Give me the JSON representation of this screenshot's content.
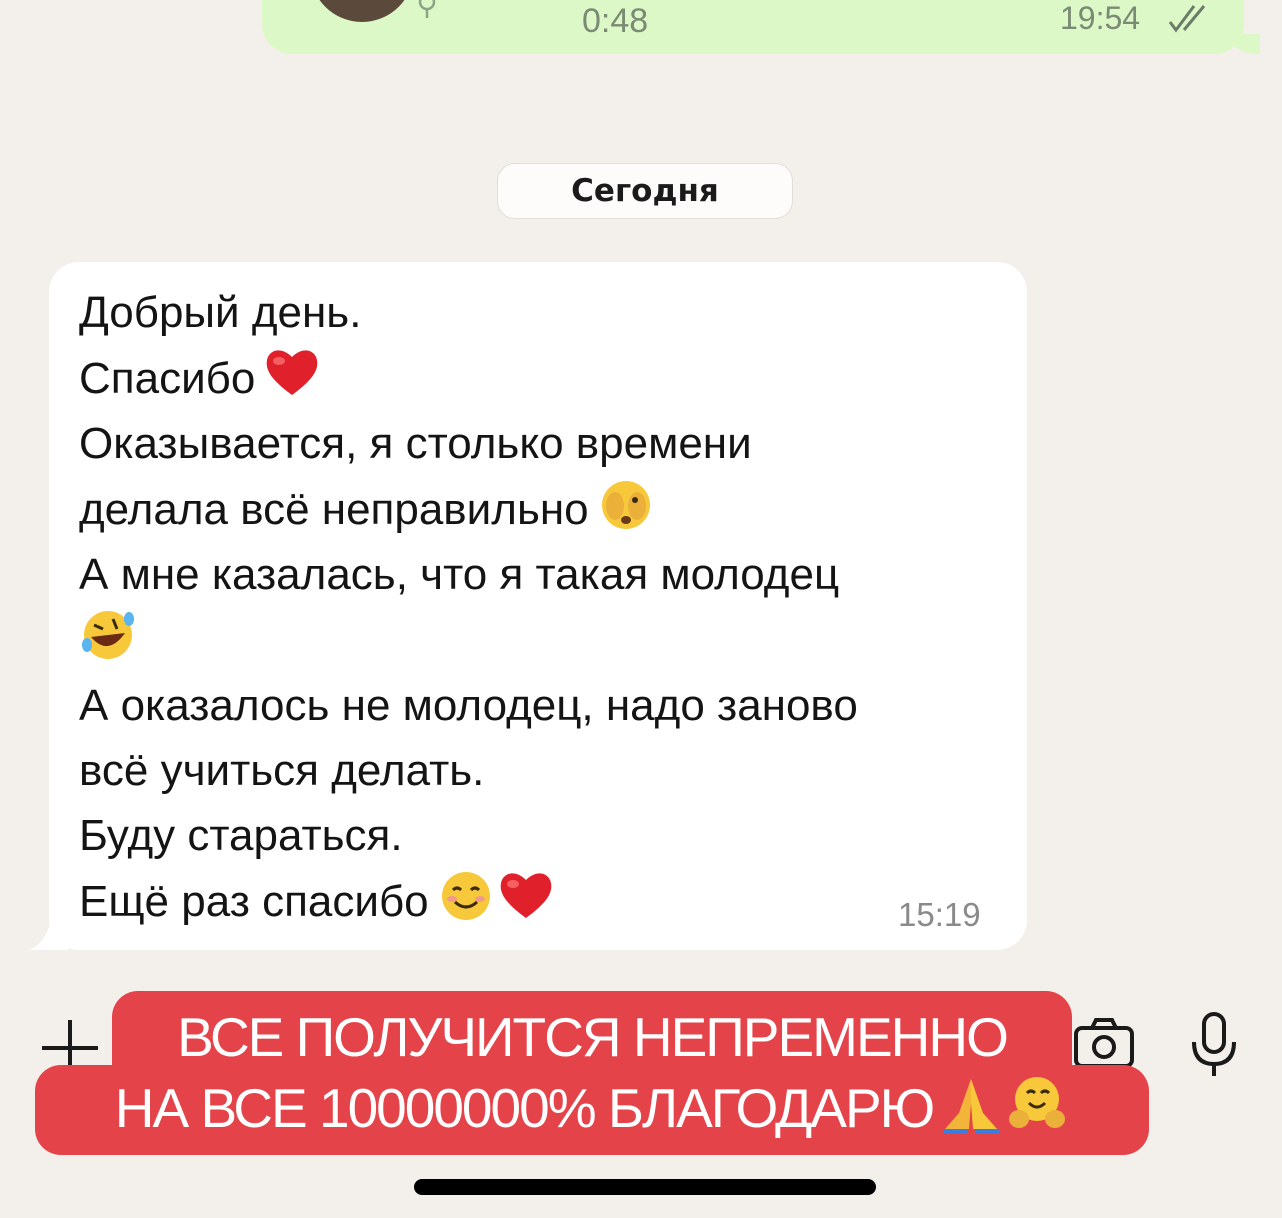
{
  "outgoing_voice_message": {
    "duration": "0:48",
    "time": "19:54",
    "status_icon": "double-check-icon"
  },
  "date_separator": "Сегодня",
  "incoming_message": {
    "lines": [
      "Добрый день.",
      "Спасибо",
      "Оказывается, я столько времени",
      "делала всё неправильно",
      "А мне казалась, что я такая молодец",
      "",
      "А оказалось не молодец, надо заново",
      "всё учиться делать.",
      "Буду стараться.",
      "Ещё раз спасибо"
    ],
    "emojis": {
      "line_2": "❤️",
      "line_4": "🫣",
      "line_6": "🤣",
      "line_10": "😊❤️"
    },
    "time": "15:19"
  },
  "composer": {
    "plus_icon": "plus-icon",
    "camera_icon": "camera-icon",
    "mic_icon": "microphone-icon"
  },
  "overlay_banner": {
    "line1": "ВСЕ ПОЛУЧИТСЯ НЕПРЕМЕННО",
    "line2": "НА ВСЕ 10000000% БЛАГОДАРЮ",
    "emojis": "🙏🤗",
    "color": "#e5434a"
  },
  "colors": {
    "background": "#f3f0eb",
    "outgoing_bubble": "#dcf8c6",
    "incoming_bubble": "#ffffff"
  }
}
